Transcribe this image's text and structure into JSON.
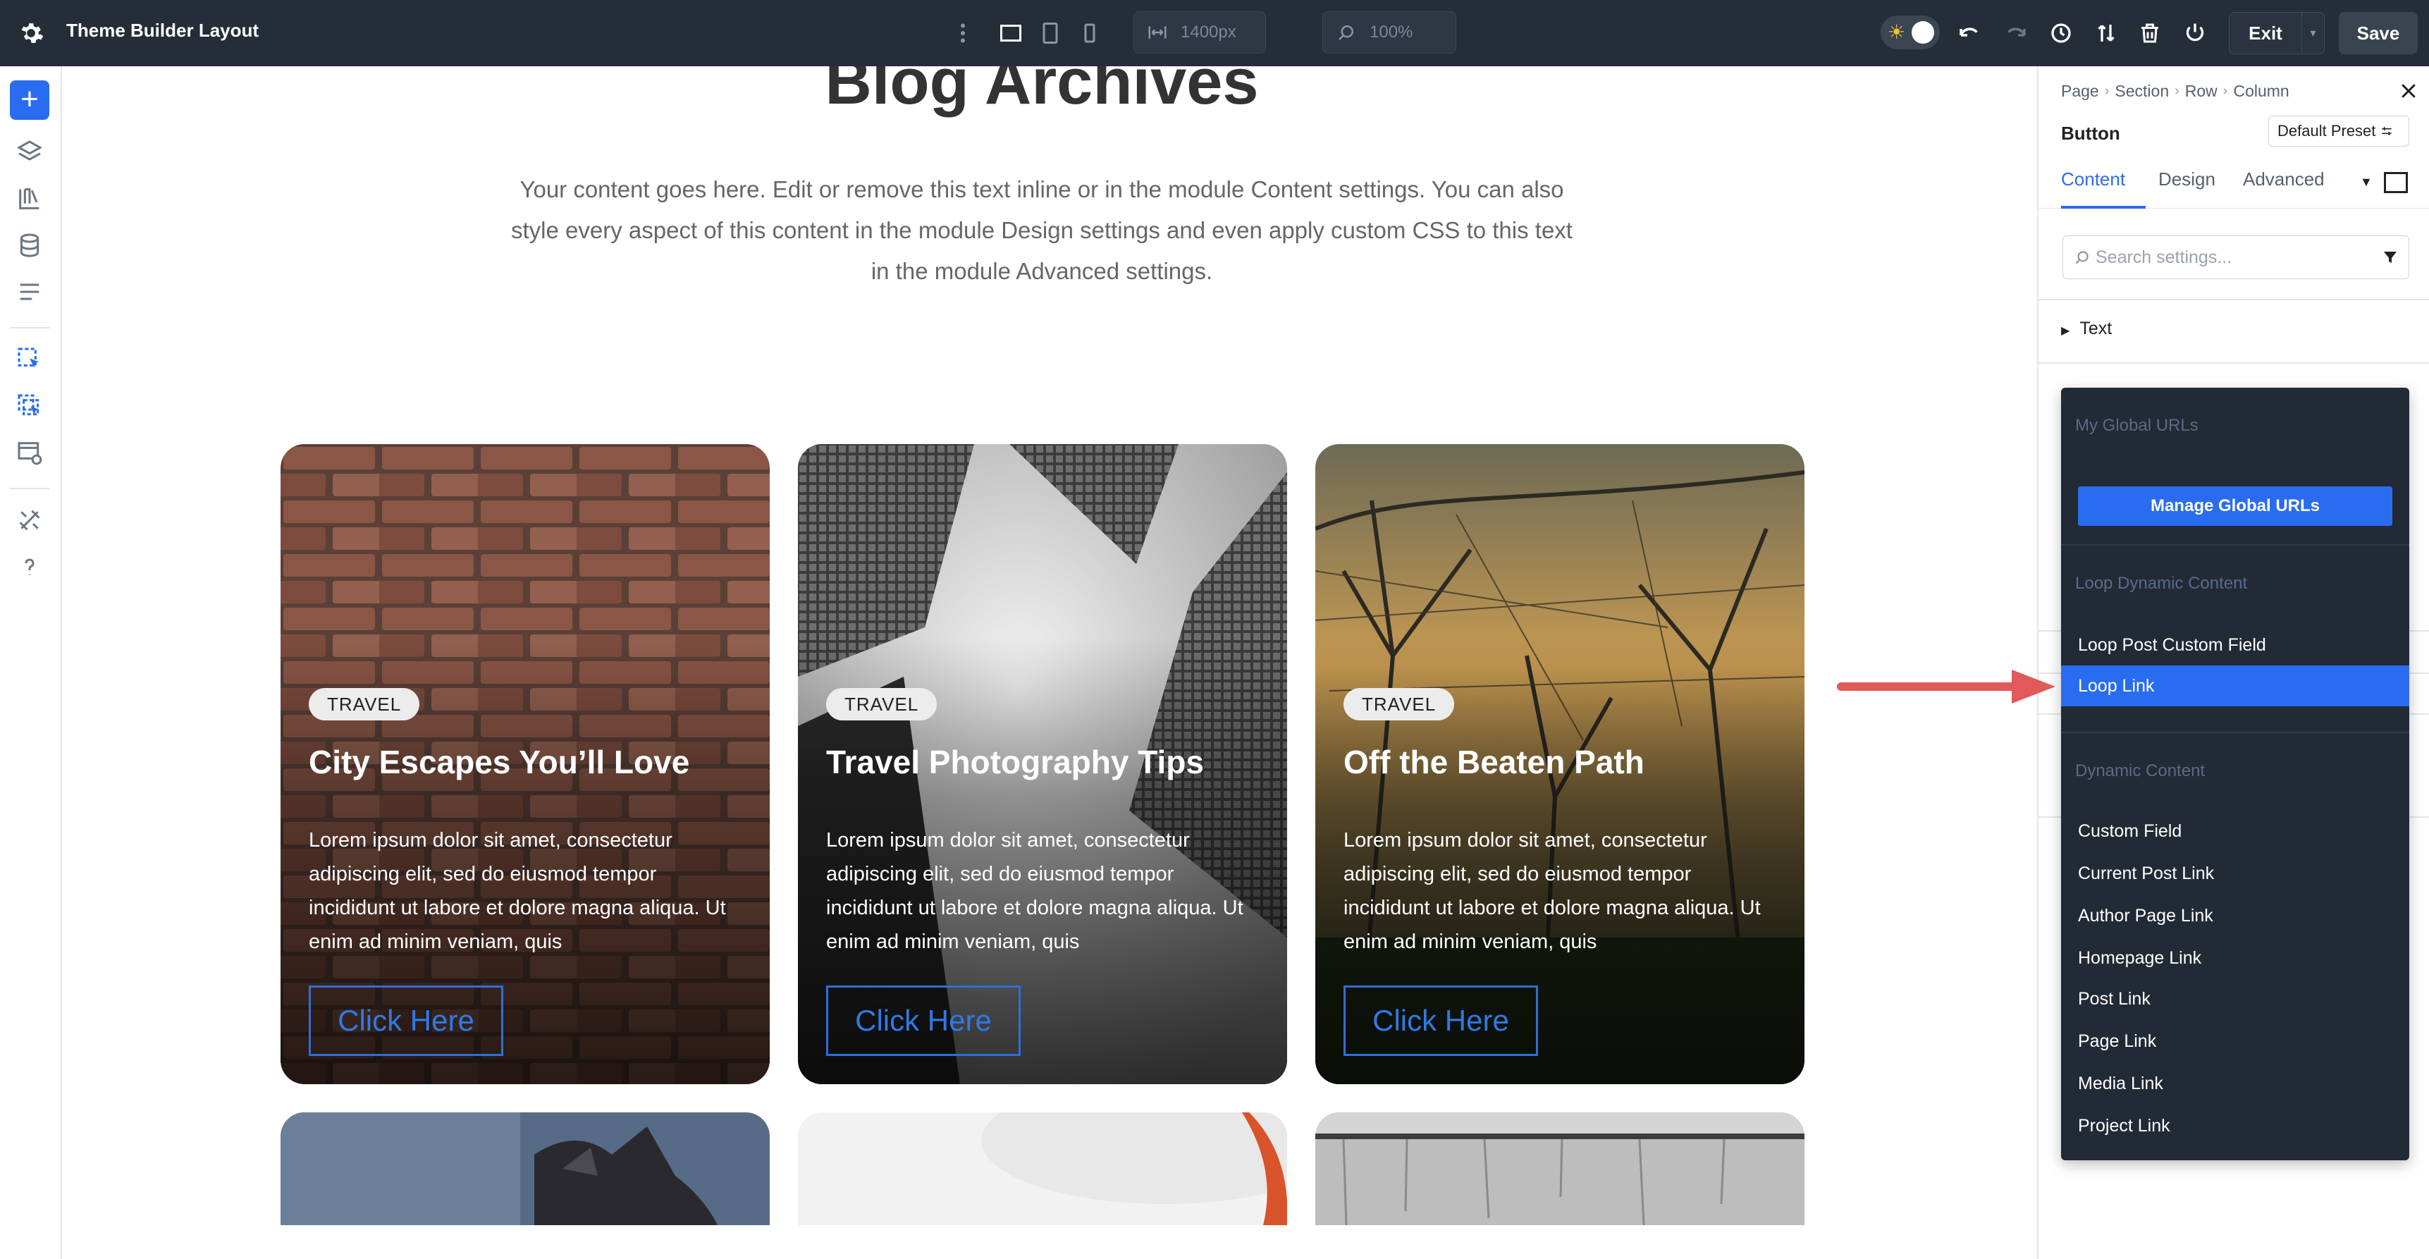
{
  "topbar": {
    "title": "Theme Builder Layout",
    "width_value": "1400px",
    "zoom_value": "100%",
    "exit_label": "Exit",
    "save_label": "Save"
  },
  "canvas": {
    "heading": "Blog Archives",
    "intro": "Your content goes here. Edit or remove this text inline or in the module Content settings. You can also style every aspect of this content in the module Design settings and even apply custom CSS to this text in the module Advanced settings.",
    "cards": [
      {
        "badge": "TRAVEL",
        "title": "City Escapes You’ll Love",
        "body": "Lorem ipsum dolor sit amet, consectetur adipiscing elit, sed do eiusmod tempor incididunt ut labore et dolore magna aliqua. Ut enim ad minim veniam, quis",
        "button": "Click Here"
      },
      {
        "badge": "TRAVEL",
        "title": "Travel Photography Tips",
        "body": "Lorem ipsum dolor sit amet, consectetur adipiscing elit, sed do eiusmod tempor incididunt ut labore et dolore magna aliqua. Ut enim ad minim veniam, quis",
        "button": "Click Here"
      },
      {
        "badge": "TRAVEL",
        "title": "Off the Beaten Path",
        "body": "Lorem ipsum dolor sit amet, consectetur adipiscing elit, sed do eiusmod tempor incididunt ut labore et dolore magna aliqua. Ut enim ad minim veniam, quis",
        "button": "Click Here"
      }
    ]
  },
  "panel": {
    "breadcrumb": [
      "Page",
      "Section",
      "Row",
      "Column"
    ],
    "title": "Button",
    "preset": "Default Preset",
    "tabs": [
      "Content",
      "Design",
      "Advanced"
    ],
    "active_tab": "Content",
    "search_placeholder": "Search settings...",
    "text_group": "Text"
  },
  "dropdown": {
    "global_header": "My Global URLs",
    "manage_button": "Manage Global URLs",
    "loop_header": "Loop Dynamic Content",
    "loop_items": [
      "Loop Post Custom Field",
      "Loop Link"
    ],
    "active_item": "Loop Link",
    "dynamic_header": "Dynamic Content",
    "dynamic_items": [
      "Custom Field",
      "Current Post Link",
      "Author Page Link",
      "Homepage Link",
      "Post Link",
      "Page Link",
      "Media Link",
      "Project Link"
    ]
  },
  "colors": {
    "accent": "#2a6cf0",
    "topbar_bg": "#252d38",
    "dropdown_bg": "#222a35",
    "annotation_arrow": "#e05a5a"
  }
}
